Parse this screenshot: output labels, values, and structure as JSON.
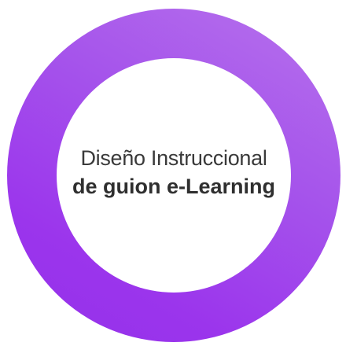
{
  "badge": {
    "line1": "Diseño Instruccional",
    "line2": "de guion e-Learning"
  },
  "colors": {
    "ring_light": "#b772ec",
    "ring_dark": "#9430ea",
    "inner": "#ffffff",
    "text": "#3a3a3a"
  }
}
